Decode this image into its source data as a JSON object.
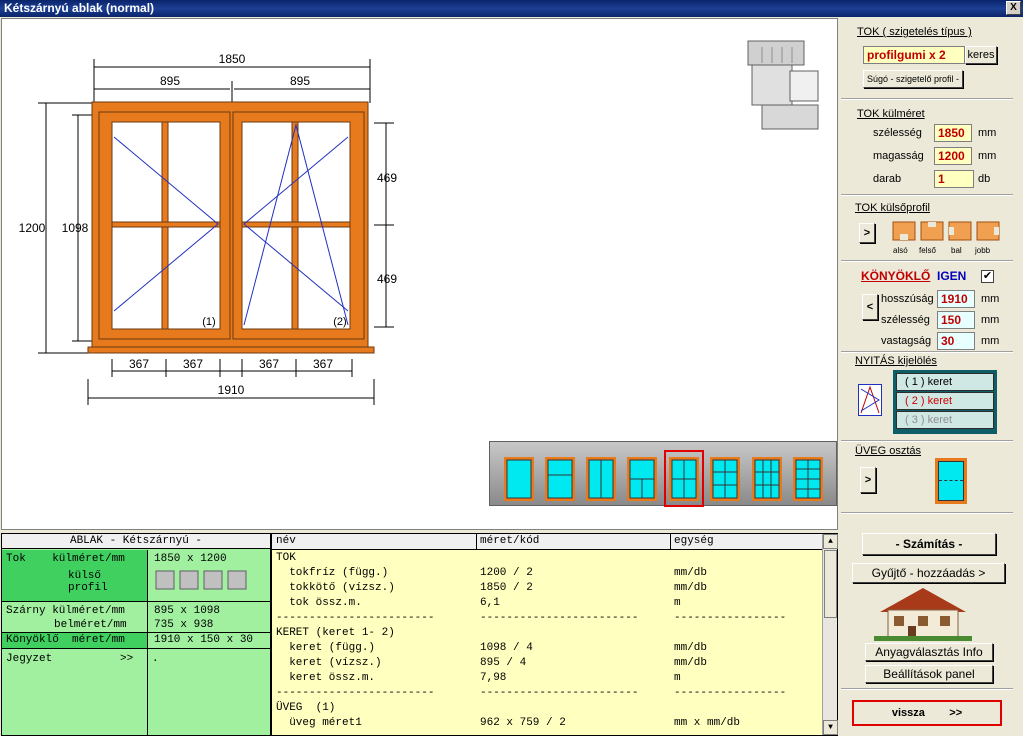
{
  "window": {
    "title": "Kétszárnyú ablak (normal)",
    "close": "X"
  },
  "drawing": {
    "dim_top": "1850",
    "dim_left_half": "895",
    "dim_right_half": "895",
    "dim_height_outer": "1200",
    "dim_height_inner": "1098",
    "dim_right_upper": "469",
    "dim_right_lower": "469",
    "dim_bottom_1": "367",
    "dim_bottom_2": "367",
    "dim_bottom_3": "367",
    "dim_bottom_4": "367",
    "dim_bottom_total": "1910",
    "sash_label_1": "(1)",
    "sash_label_2": "(2)"
  },
  "right_panel": {
    "tok_title": "TOK ( szigetelés típus )",
    "tok_value": "profilgumi x 2",
    "keres_button": "keres",
    "sugo_button": "Súgó - szigetelő profil -",
    "kulmeret_title": "TOK külméret",
    "szelesseg_label": "szélesség",
    "szelesseg_value": "1850",
    "magassag_label": "magasság",
    "magassag_value": "1200",
    "darab_label": "darab",
    "darab_value": "1",
    "unit_mm": "mm",
    "unit_db": "db",
    "kulsoprofil_title": "TOK külsőprofil",
    "profile_labels": [
      "alsó",
      "felső",
      "bal",
      "jobb"
    ],
    "konyoklo_title": "KÖNYÖKLŐ",
    "konyoklo_igen": "IGEN",
    "hosszusag_label": "hosszúság",
    "hosszusag_value": "1910",
    "kszelesseg_label": "szélesség",
    "kszelesseg_value": "150",
    "vastagsag_label": "vastagság",
    "vastagsag_value": "30",
    "nyitas_title": "NYITÁS kijelölés",
    "nyitas_items": [
      "( 1 )  keret",
      "( 2 )  keret",
      "( 3 )  keret"
    ],
    "uveg_title": "ÜVEG osztás",
    "arrow_right": ">",
    "arrow_left": "<",
    "szamitas_button": "- Számítás -",
    "gyujto_button": "Gyűjtő - hozzáadás >",
    "anyag_button": "Anyagválasztás Info",
    "beallitasok_button": "Beállítások panel",
    "vissza_button": "vissza        >>"
  },
  "summary": {
    "header": "ABLAK - Kétszárnyú -",
    "tok_label": "Tok    külméret/mm",
    "tok_value": "1850 x 1200",
    "kulso_label": "külső profil",
    "szarny_label": "Szárny külméret/mm",
    "szarny_value": "895 x 1098",
    "bel_label": "belméret/mm",
    "bel_value": "735 x 938",
    "kony_label": "Könyöklő  méret/mm",
    "kony_value": "1910 x 150 x 30",
    "jegyzet_label": "Jegyzet",
    "jegyzet_arrow": ">>",
    "jegyzet_value": "."
  },
  "details": {
    "headers": [
      "név",
      "méret/kód",
      "egység"
    ],
    "rows": [
      [
        "TOK",
        "",
        ""
      ],
      [
        "  tokfríz (függ.)",
        "1200 / 2",
        "mm/db"
      ],
      [
        "  tokkötő (vízsz.)",
        "1850 / 2",
        "mm/db"
      ],
      [
        "  tok össz.m.",
        "6,1",
        "m"
      ],
      [
        "------------------------",
        "------------------------",
        "-----------------"
      ],
      [
        "KERET (keret 1- 2)",
        "",
        ""
      ],
      [
        "  keret (függ.)",
        "1098 / 4",
        "mm/db"
      ],
      [
        "  keret (vízsz.)",
        "895 / 4",
        "mm/db"
      ],
      [
        "  keret össz.m.",
        "7,98",
        "m"
      ],
      [
        "------------------------",
        "------------------------",
        "-----------------"
      ],
      [
        "ÜVEG  (1)",
        "",
        ""
      ],
      [
        "  üveg méret1",
        "962 x 759 / 2",
        "mm x mm/db"
      ]
    ]
  },
  "colors": {
    "frame": "#e87a1e",
    "glass_icon": "#00e8f0",
    "panel_bg": "#ece9d8",
    "green": "#a0f0a0",
    "yellow": "#ffffc0"
  }
}
